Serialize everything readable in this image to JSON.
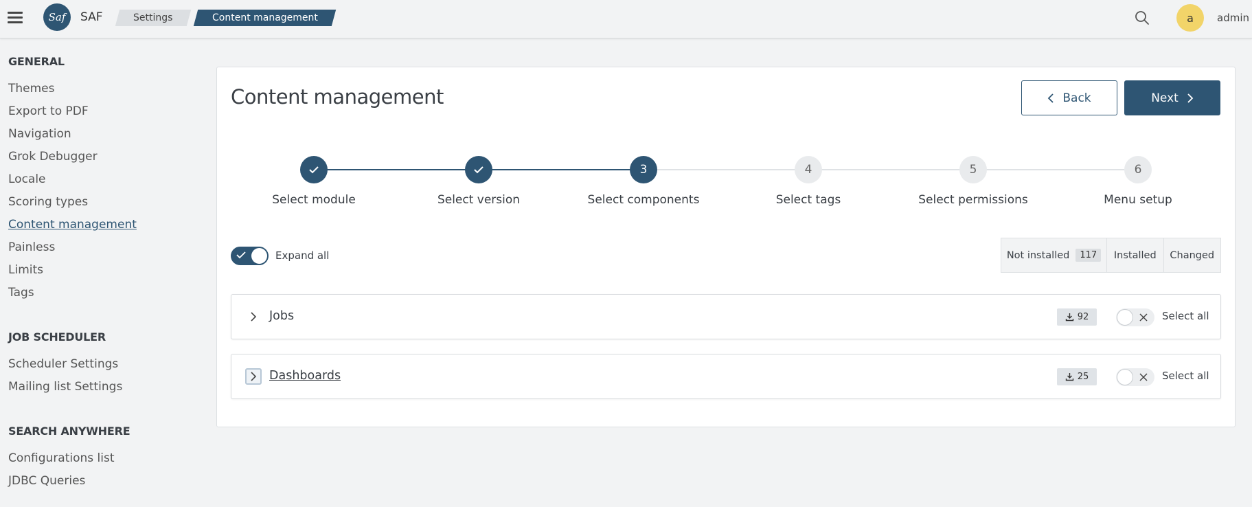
{
  "header": {
    "logo_text": "Saf",
    "app_name": "SAF",
    "breadcrumbs": [
      "Settings",
      "Content management"
    ],
    "avatar_letter": "a",
    "username": "admin"
  },
  "sidebar": {
    "sections": [
      {
        "title": "GENERAL",
        "items": [
          "Themes",
          "Export to PDF",
          "Navigation",
          "Grok Debugger",
          "Locale",
          "Scoring types",
          "Content management",
          "Painless",
          "Limits",
          "Tags"
        ]
      },
      {
        "title": "JOB SCHEDULER",
        "items": [
          "Scheduler Settings",
          "Mailing list Settings"
        ]
      },
      {
        "title": "SEARCH ANYWHERE",
        "items": [
          "Configurations list",
          "JDBC Queries"
        ]
      }
    ],
    "active_item": "Content management"
  },
  "main": {
    "title": "Content management",
    "back_label": "Back",
    "next_label": "Next",
    "steps": [
      {
        "number": "1",
        "label": "Select module",
        "state": "done"
      },
      {
        "number": "2",
        "label": "Select version",
        "state": "done"
      },
      {
        "number": "3",
        "label": "Select components",
        "state": "current"
      },
      {
        "number": "4",
        "label": "Select tags",
        "state": "pending"
      },
      {
        "number": "5",
        "label": "Select permissions",
        "state": "pending"
      },
      {
        "number": "6",
        "label": "Menu setup",
        "state": "pending"
      }
    ],
    "expand_all_label": "Expand all",
    "expand_all_on": true,
    "filters": {
      "not_installed_label": "Not installed",
      "not_installed_count": "117",
      "installed_label": "Installed",
      "changed_label": "Changed"
    },
    "groups": [
      {
        "name": "Jobs",
        "download_count": "92",
        "select_all_label": "Select all"
      },
      {
        "name": "Dashboards",
        "download_count": "25",
        "select_all_label": "Select all"
      }
    ]
  },
  "colors": {
    "primary": "#2e5573",
    "avatar": "#f2d469",
    "background": "#f2f3f4"
  },
  "icons": [
    "menu-icon",
    "search-icon",
    "check-icon",
    "chevron-left-icon",
    "chevron-right-icon",
    "download-icon",
    "close-icon"
  ]
}
